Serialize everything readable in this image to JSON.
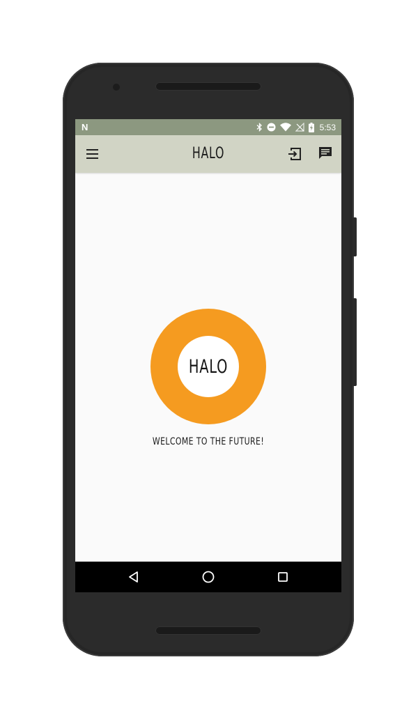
{
  "status_bar": {
    "carrier_icon": "n-notification-icon",
    "carrier_glyph": "N",
    "icons": [
      "bluetooth-icon",
      "do-not-disturb-icon",
      "wifi-icon",
      "no-sim-icon",
      "battery-charging-icon"
    ],
    "time": "5:53",
    "background": "#8c9880"
  },
  "app_bar": {
    "title": "HALO",
    "menu_icon": "hamburger-menu-icon",
    "actions": [
      "login-icon",
      "chat-icon"
    ],
    "background": "#d1d4c5"
  },
  "main": {
    "logo_text": "HALO",
    "logo_color": "#f59b20",
    "welcome_text": "WELCOME TO THE FUTURE!"
  },
  "nav_bar": {
    "buttons": [
      "back-icon",
      "home-icon",
      "recents-icon"
    ]
  }
}
